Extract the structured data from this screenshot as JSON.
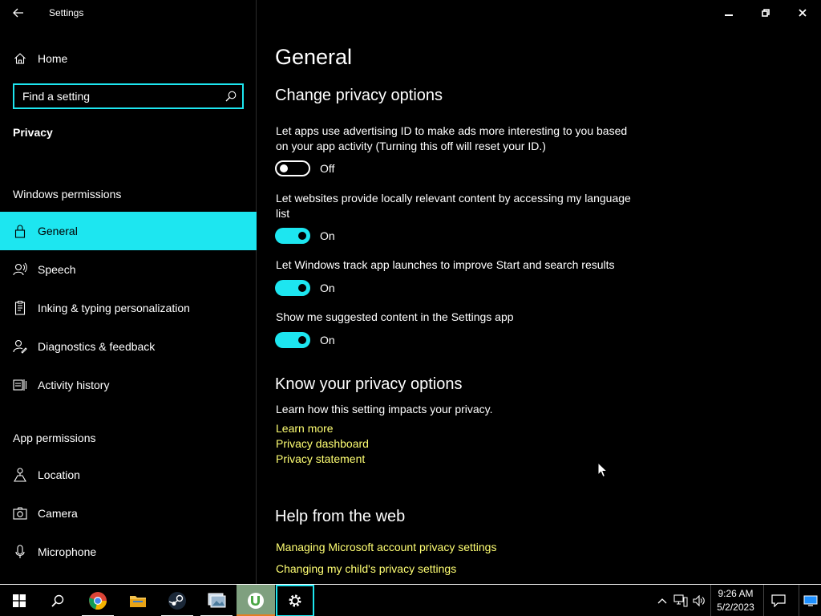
{
  "app": {
    "title": "Settings"
  },
  "sidebar": {
    "home_label": "Home",
    "search_placeholder": "Find a setting",
    "current_section": "Privacy",
    "groups": {
      "windows_permissions": "Windows permissions",
      "app_permissions": "App permissions"
    },
    "items": [
      {
        "label": "General",
        "icon": "lock-icon",
        "selected": true
      },
      {
        "label": "Speech",
        "icon": "speech-icon"
      },
      {
        "label": "Inking & typing personalization",
        "icon": "inking-icon"
      },
      {
        "label": "Diagnostics & feedback",
        "icon": "feedback-icon"
      },
      {
        "label": "Activity history",
        "icon": "activity-icon"
      },
      {
        "label": "Location",
        "icon": "location-icon"
      },
      {
        "label": "Camera",
        "icon": "camera-icon"
      },
      {
        "label": "Microphone",
        "icon": "microphone-icon"
      }
    ]
  },
  "main": {
    "title": "General",
    "change_section": {
      "heading": "Change privacy options",
      "options": [
        {
          "text": "Let apps use advertising ID to make ads more interesting to you based on your app activity (Turning this off will reset your ID.)",
          "state": "Off"
        },
        {
          "text": "Let websites provide locally relevant content by accessing my language list",
          "state": "On"
        },
        {
          "text": "Let Windows track app launches to improve Start and search results",
          "state": "On"
        },
        {
          "text": "Show me suggested content in the Settings app",
          "state": "On"
        }
      ]
    },
    "know_section": {
      "heading": "Know your privacy options",
      "text": "Learn how this setting impacts your privacy.",
      "links": [
        "Learn more",
        "Privacy dashboard",
        "Privacy statement"
      ]
    },
    "help_section": {
      "heading": "Help from the web",
      "links": [
        "Managing Microsoft account privacy settings",
        "Changing my child's privacy settings"
      ]
    }
  },
  "taskbar": {
    "apps": [
      "start-icon",
      "search-icon",
      "chrome-icon",
      "file-explorer-icon",
      "steam-icon",
      "photos-icon",
      "utorrent-icon",
      "settings-icon"
    ],
    "clock": {
      "time": "9:26 AM",
      "date": "5/2/2023"
    }
  },
  "colors": {
    "accent": "#1de6f0",
    "link": "#ffff73",
    "background": "#000000",
    "text": "#ffffff"
  }
}
